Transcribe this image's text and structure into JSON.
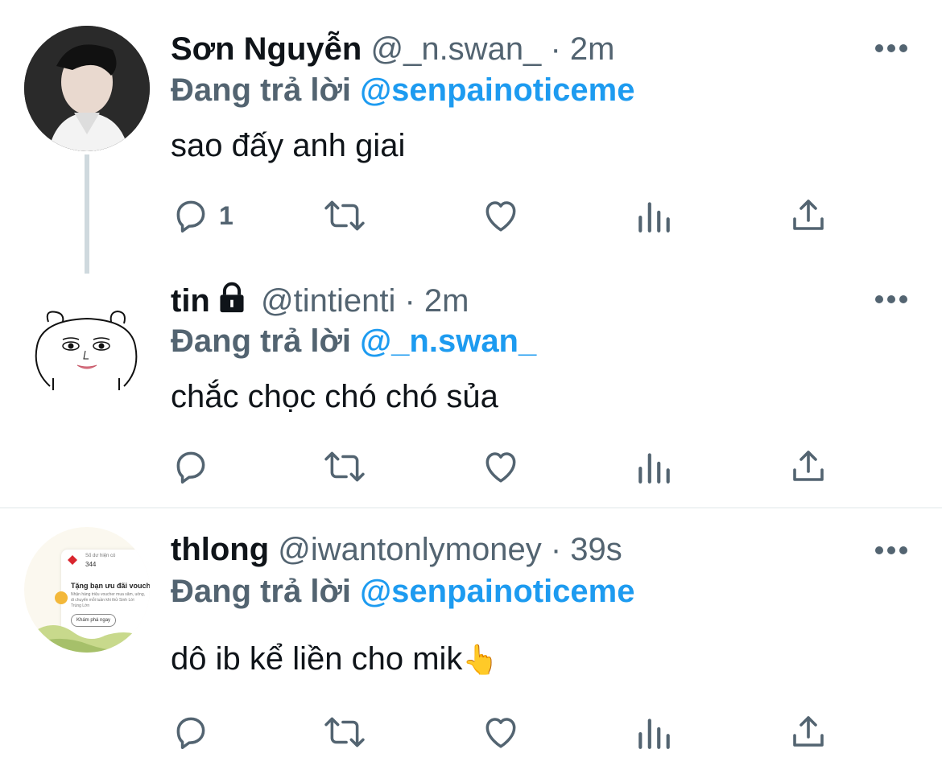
{
  "colors": {
    "text": "#0f1419",
    "secondary": "#536471",
    "accent": "#1d9bf0",
    "divider": "#eff3f4"
  },
  "tweets": [
    {
      "name": "Sơn Nguyễn",
      "handle": "@_n.swan_",
      "dot": "·",
      "time": "2m",
      "reply_prefix": "Đang trả lời",
      "reply_to": "@senpainoticeme",
      "text": "sao đấy anh giai",
      "reply_count": "1",
      "protected": false
    },
    {
      "name": "tin",
      "handle": "@tintienti",
      "dot": "·",
      "time": "2m",
      "reply_prefix": "Đang trả lời",
      "reply_to": "@_n.swan_",
      "text": "chắc chọc chó chó sủa",
      "reply_count": "",
      "protected": true
    },
    {
      "name": "thlong",
      "handle": "@iwantonlymoney",
      "dot": "·",
      "time": "39s",
      "reply_prefix": "Đang trả lời",
      "reply_to": "@senpainoticeme",
      "text": "dô ib kể liền cho mik",
      "emoji": "👆",
      "reply_count": "",
      "protected": false,
      "avatar_card": {
        "label": "Số dư hiện có",
        "balance": "344",
        "title": "Tặng bạn ưu đãi voucher",
        "body": "Nhận hàng triệu voucher mua sắm, uống, di chuyển mỗi tuần khi thử Sinh Lời Trúng Lớn",
        "button": "Khám phá ngay"
      }
    }
  ],
  "icons": {
    "reply": "reply-icon",
    "retweet": "retweet-icon",
    "like": "heart-icon",
    "views": "views-icon",
    "share": "share-icon",
    "more": "more-icon",
    "lock": "lock-icon"
  }
}
